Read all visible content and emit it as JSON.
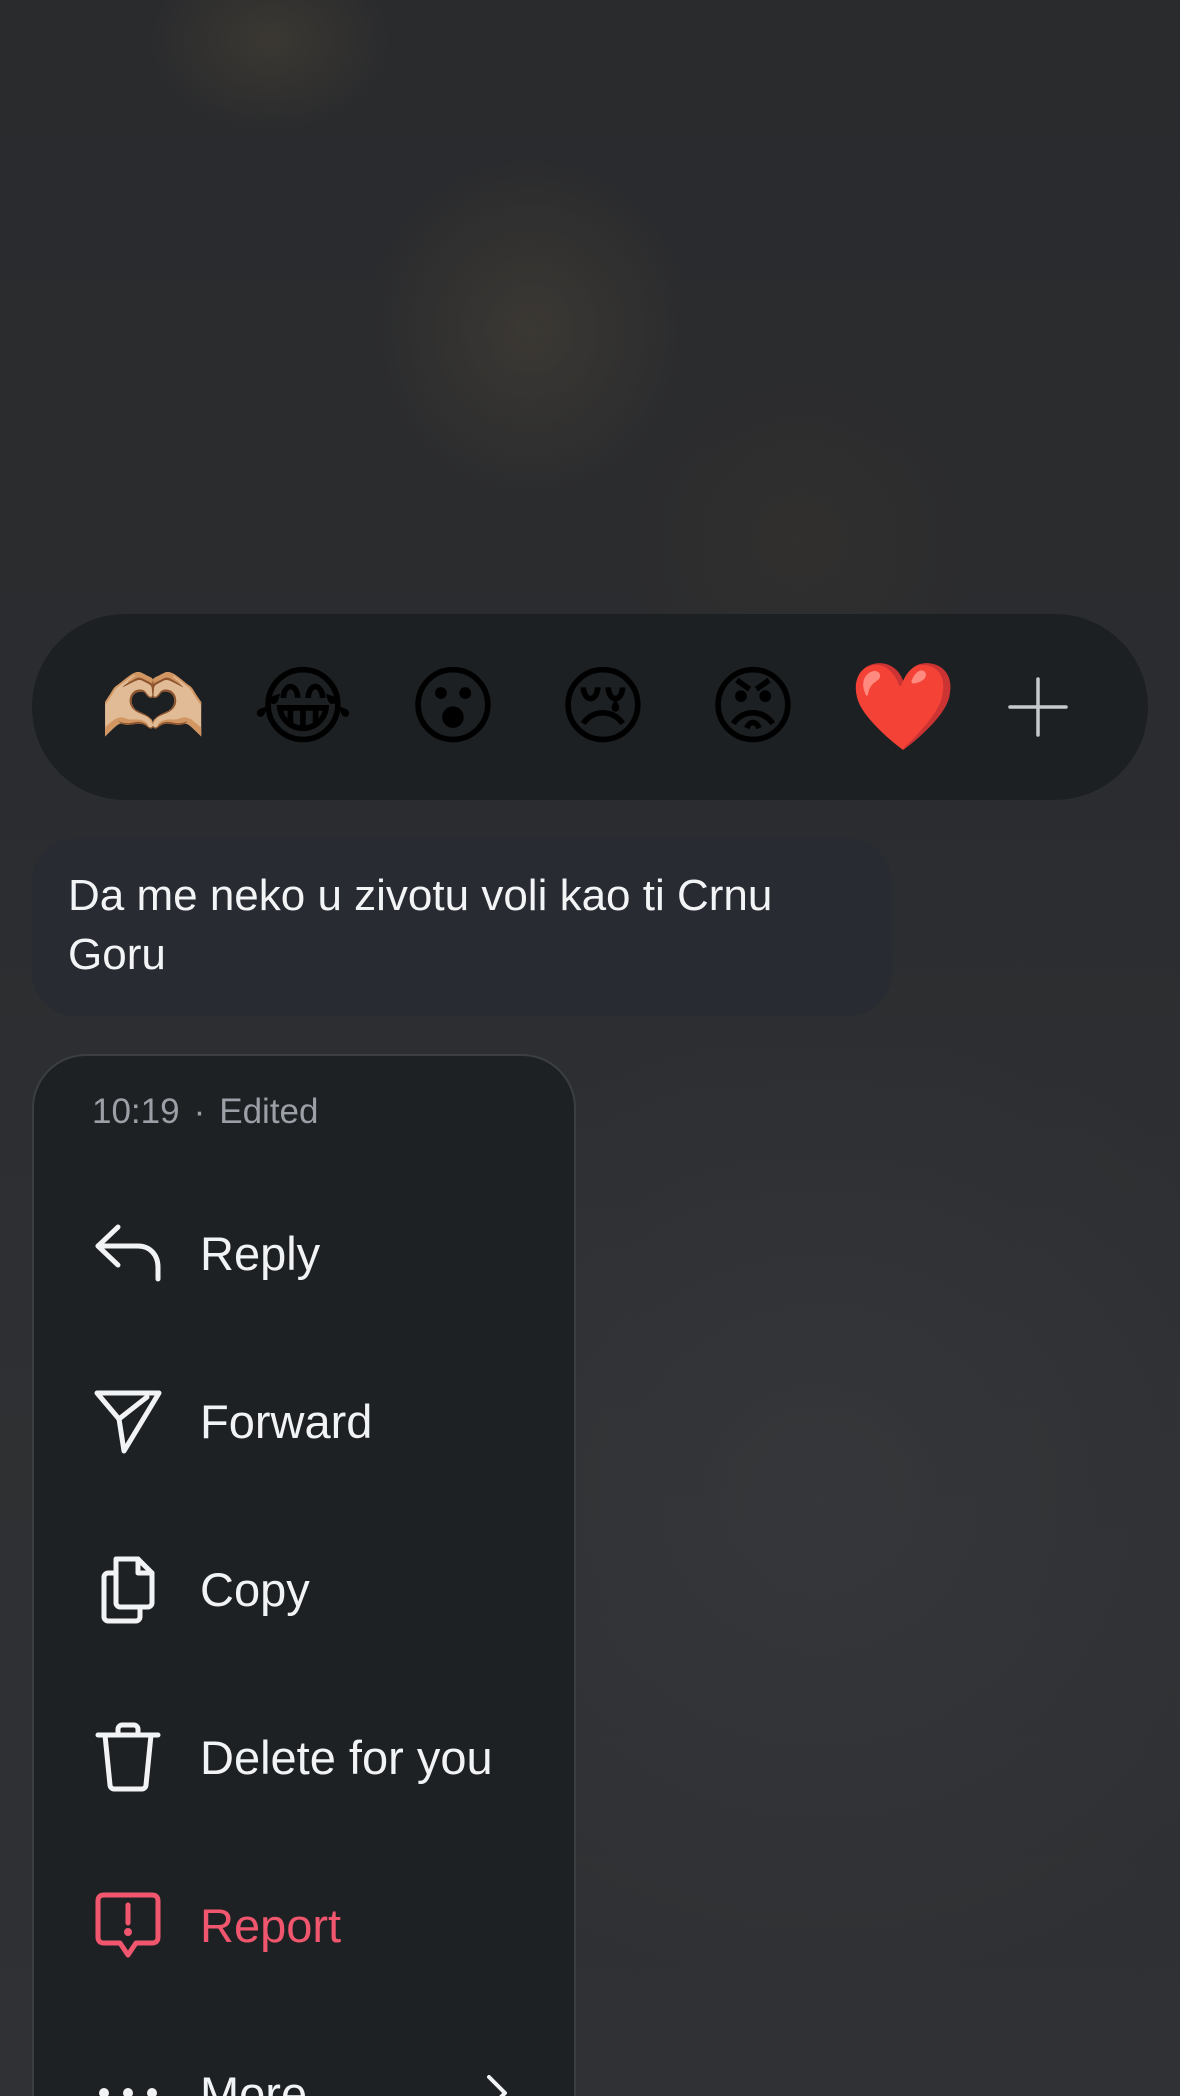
{
  "reactions": [
    {
      "emoji": "🫶🏼",
      "icon": "heart-hands-icon"
    },
    {
      "emoji": "😂",
      "icon": "tears-of-joy-icon"
    },
    {
      "emoji": "😮",
      "icon": "open-mouth-icon"
    },
    {
      "emoji": "😢",
      "icon": "crying-face-icon"
    },
    {
      "emoji": "😡",
      "icon": "angry-face-icon"
    },
    {
      "emoji": "❤️",
      "icon": "red-heart-icon"
    }
  ],
  "message": {
    "text": "Da me neko u zivotu voli kao ti Crnu Goru"
  },
  "menu": {
    "time": "10:19",
    "separator": "·",
    "status": "Edited",
    "items": [
      {
        "label": "Reply",
        "icon": "reply-icon"
      },
      {
        "label": "Forward",
        "icon": "forward-icon"
      },
      {
        "label": "Copy",
        "icon": "copy-icon"
      },
      {
        "label": "Delete for you",
        "icon": "trash-icon"
      },
      {
        "label": "Report",
        "icon": "report-icon"
      },
      {
        "label": "More",
        "icon": "more-icon"
      }
    ]
  },
  "colors": {
    "danger": "#f0566d",
    "menu_bg": "#1e2123",
    "bubble_bg": "#282b31"
  }
}
